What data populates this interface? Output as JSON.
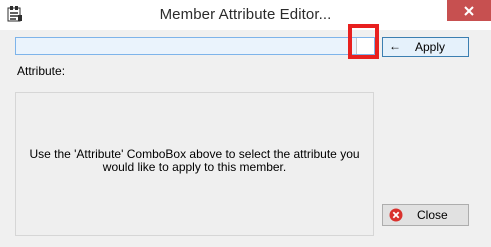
{
  "window": {
    "title": "Member Attribute Editor..."
  },
  "toolbar": {
    "apply_label": "Apply",
    "apply_arrow": "←"
  },
  "attribute": {
    "label": "Attribute:",
    "combobox_value": ""
  },
  "info": {
    "message_line1": "Use the 'Attribute' ComboBox above to select the attribute you",
    "message_line2": "would like to apply to this member."
  },
  "footer": {
    "close_label": "Close"
  },
  "colors": {
    "highlight": "#e8201f",
    "close_titlebar": "#c75050",
    "combobox_bg": "#eaf3fc",
    "combobox_border": "#7eb4ea",
    "apply_border": "#3c7fb1",
    "close_icon_red": "#d9312d"
  },
  "icons": {
    "app": "editor-app-icon",
    "window_close": "window-close-icon",
    "apply": "arrow-left-icon",
    "close": "close-circle-icon"
  }
}
